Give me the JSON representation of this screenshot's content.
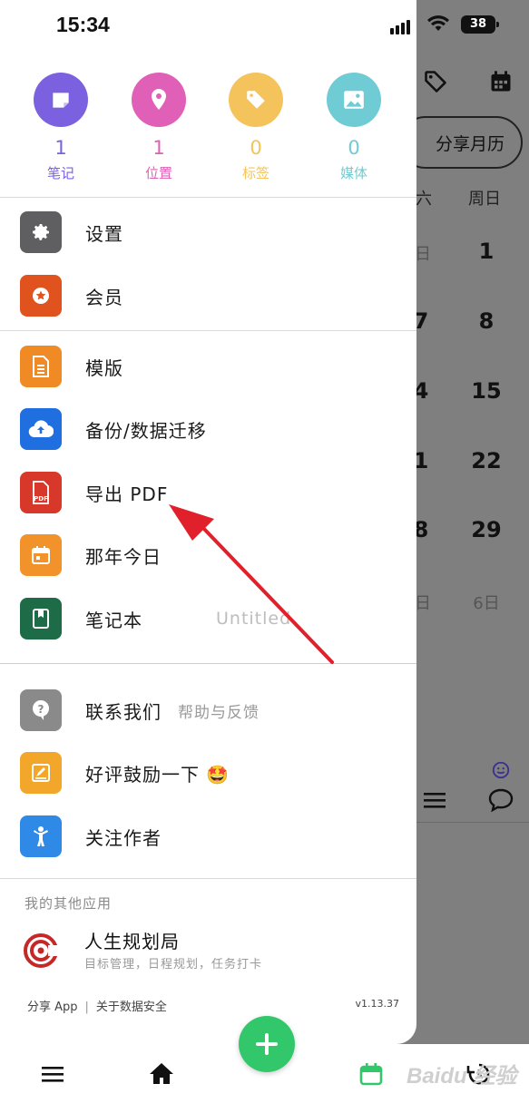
{
  "status_bar": {
    "time": "15:34",
    "battery": "38"
  },
  "background": {
    "share_calendar": "分享月历",
    "weekday_sat": "六",
    "weekday_sun": "周日",
    "days_col1": [
      "日",
      "7",
      "4",
      "1",
      "8",
      "日"
    ],
    "days_col2": [
      "1",
      "8",
      "15",
      "22",
      "29",
      "6日"
    ]
  },
  "stats": [
    {
      "count": "1",
      "label": "笔记",
      "color": "#7b61e0",
      "icon": "note-icon"
    },
    {
      "count": "1",
      "label": "位置",
      "color": "#e05fb7",
      "icon": "location-pin-icon"
    },
    {
      "count": "0",
      "label": "标签",
      "color": "#f5c35b",
      "icon": "tag-icon"
    },
    {
      "count": "0",
      "label": "媒体",
      "color": "#6fcbd4",
      "icon": "image-icon"
    }
  ],
  "menu": {
    "settings": "设置",
    "membership": "会员",
    "templates": "模版",
    "backup": "备份/数据迁移",
    "export_pdf": "导出 PDF",
    "on_this_day": "那年今日",
    "notebook": "笔记本",
    "notebook_value": "Untitled",
    "contact": "联系我们",
    "contact_sub": "帮助与反馈",
    "rate": "好评鼓励一下 🤩",
    "follow": "关注作者"
  },
  "other_apps": {
    "title": "我的其他应用",
    "app_name": "人生规划局",
    "app_desc": "目标管理，日程规划，任务打卡"
  },
  "footer": {
    "share": "分享 App",
    "divider": "|",
    "privacy": "关于数据安全",
    "version": "v1.13.37"
  },
  "colors": {
    "settings_bg": "#5f5f62",
    "membership_bg": "#e0531f",
    "templates_bg": "#f08a24",
    "backup_bg": "#1f6fe0",
    "export_bg": "#d8382a",
    "on_this_day_bg": "#f2922a",
    "notebook_bg": "#1e6b47",
    "contact_bg": "#8a8a8a",
    "rate_bg": "#f2a62a",
    "follow_bg": "#2e8ae6",
    "accent_green": "#33c76b",
    "arrow_red": "#e0202a"
  },
  "watermark": "Baidu 经验"
}
